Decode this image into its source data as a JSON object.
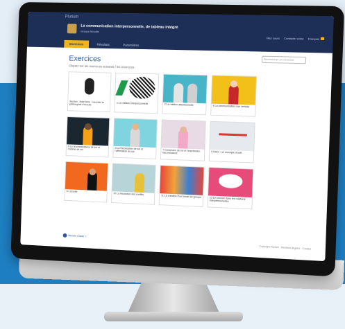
{
  "header": {
    "brand": "Plurium",
    "course_title": "La communication interpersonnelle, de tableau intégré",
    "course_sub": "Groupe Moodle",
    "nav": [
      "Mes cours",
      "Contacter notre",
      "Français"
    ]
  },
  "tabs": [
    {
      "label": "Exercices"
    },
    {
      "label": "Résultats"
    },
    {
      "label": "Paramètres"
    }
  ],
  "main": {
    "title": "Exercices",
    "intro": "Cliquez sur les exercices suivants / les exercices",
    "search_placeholder": "Rechercher un exercice"
  },
  "cards": [
    {
      "label": "Section : Note fiche : raconter la philosophie d'écoute"
    },
    {
      "label": "2  La relation interpersonnelle"
    },
    {
      "label": "3  La relation attentionnelle"
    },
    {
      "label": "4  La communication non verbale"
    },
    {
      "label": "5  La reconnaissance de soi et l'estime de soi"
    },
    {
      "label": "6  La théorisation de soi et l'affirmation de soi"
    },
    {
      "label": "7  Construire de soi et l'expression des émotions"
    },
    {
      "label": "8  DISC : un exemple d'outil"
    },
    {
      "label": "9  L'écoute"
    },
    {
      "label": "10  La résolution des conflits"
    },
    {
      "label": "11  La création d'un travail de groupe"
    },
    {
      "label": "12  Le pouvoir dans les relations interpersonnelles"
    }
  ],
  "footer": {
    "help": "Besoin d'aide ?",
    "right": "Copyright Plurium · Mentions légales · Contact"
  },
  "colors": {
    "header_bg": "#1e2f57",
    "tab_active": "#f3b41b",
    "band": "#1d7fc2"
  }
}
